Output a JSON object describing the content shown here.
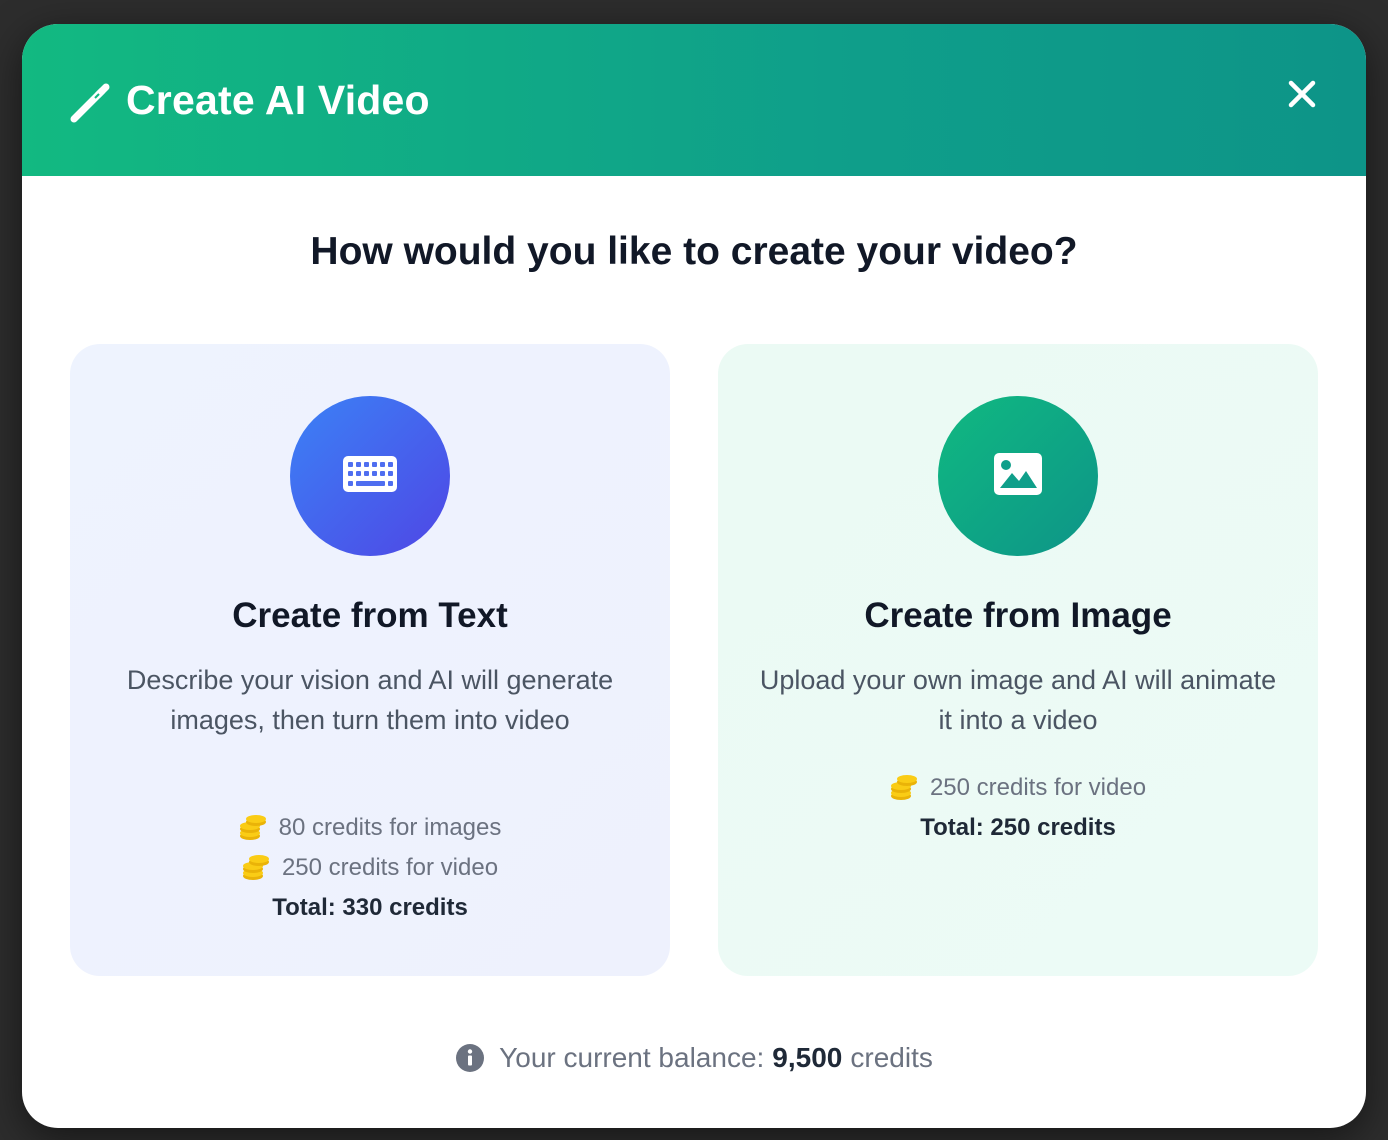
{
  "header": {
    "title": "Create AI Video",
    "icon": "magic-wand-icon",
    "close_icon": "close-icon",
    "gradient": [
      "#12b981",
      "#0d9488"
    ]
  },
  "question": "How would you like to create your video?",
  "cards": [
    {
      "title": "Create from Text",
      "icon": "keyboard-icon",
      "description": "Describe your vision and AI will generate images, then turn them into video",
      "credits": [
        {
          "icon": "coins-icon",
          "label": "80 credits for images"
        },
        {
          "icon": "coins-icon",
          "label": "250 credits for video"
        }
      ],
      "total": "Total: 330 credits",
      "accent": "#3b82f6"
    },
    {
      "title": "Create from Image",
      "icon": "image-icon",
      "description": "Upload your own image and AI will animate it into a video",
      "credits": [
        {
          "icon": "coins-icon",
          "label": "250 credits for video"
        }
      ],
      "total": "Total: 250 credits",
      "accent": "#10b981"
    }
  ],
  "balance": {
    "icon": "info-icon",
    "prefix": "Your current balance:",
    "amount": "9,500",
    "suffix": "credits"
  }
}
